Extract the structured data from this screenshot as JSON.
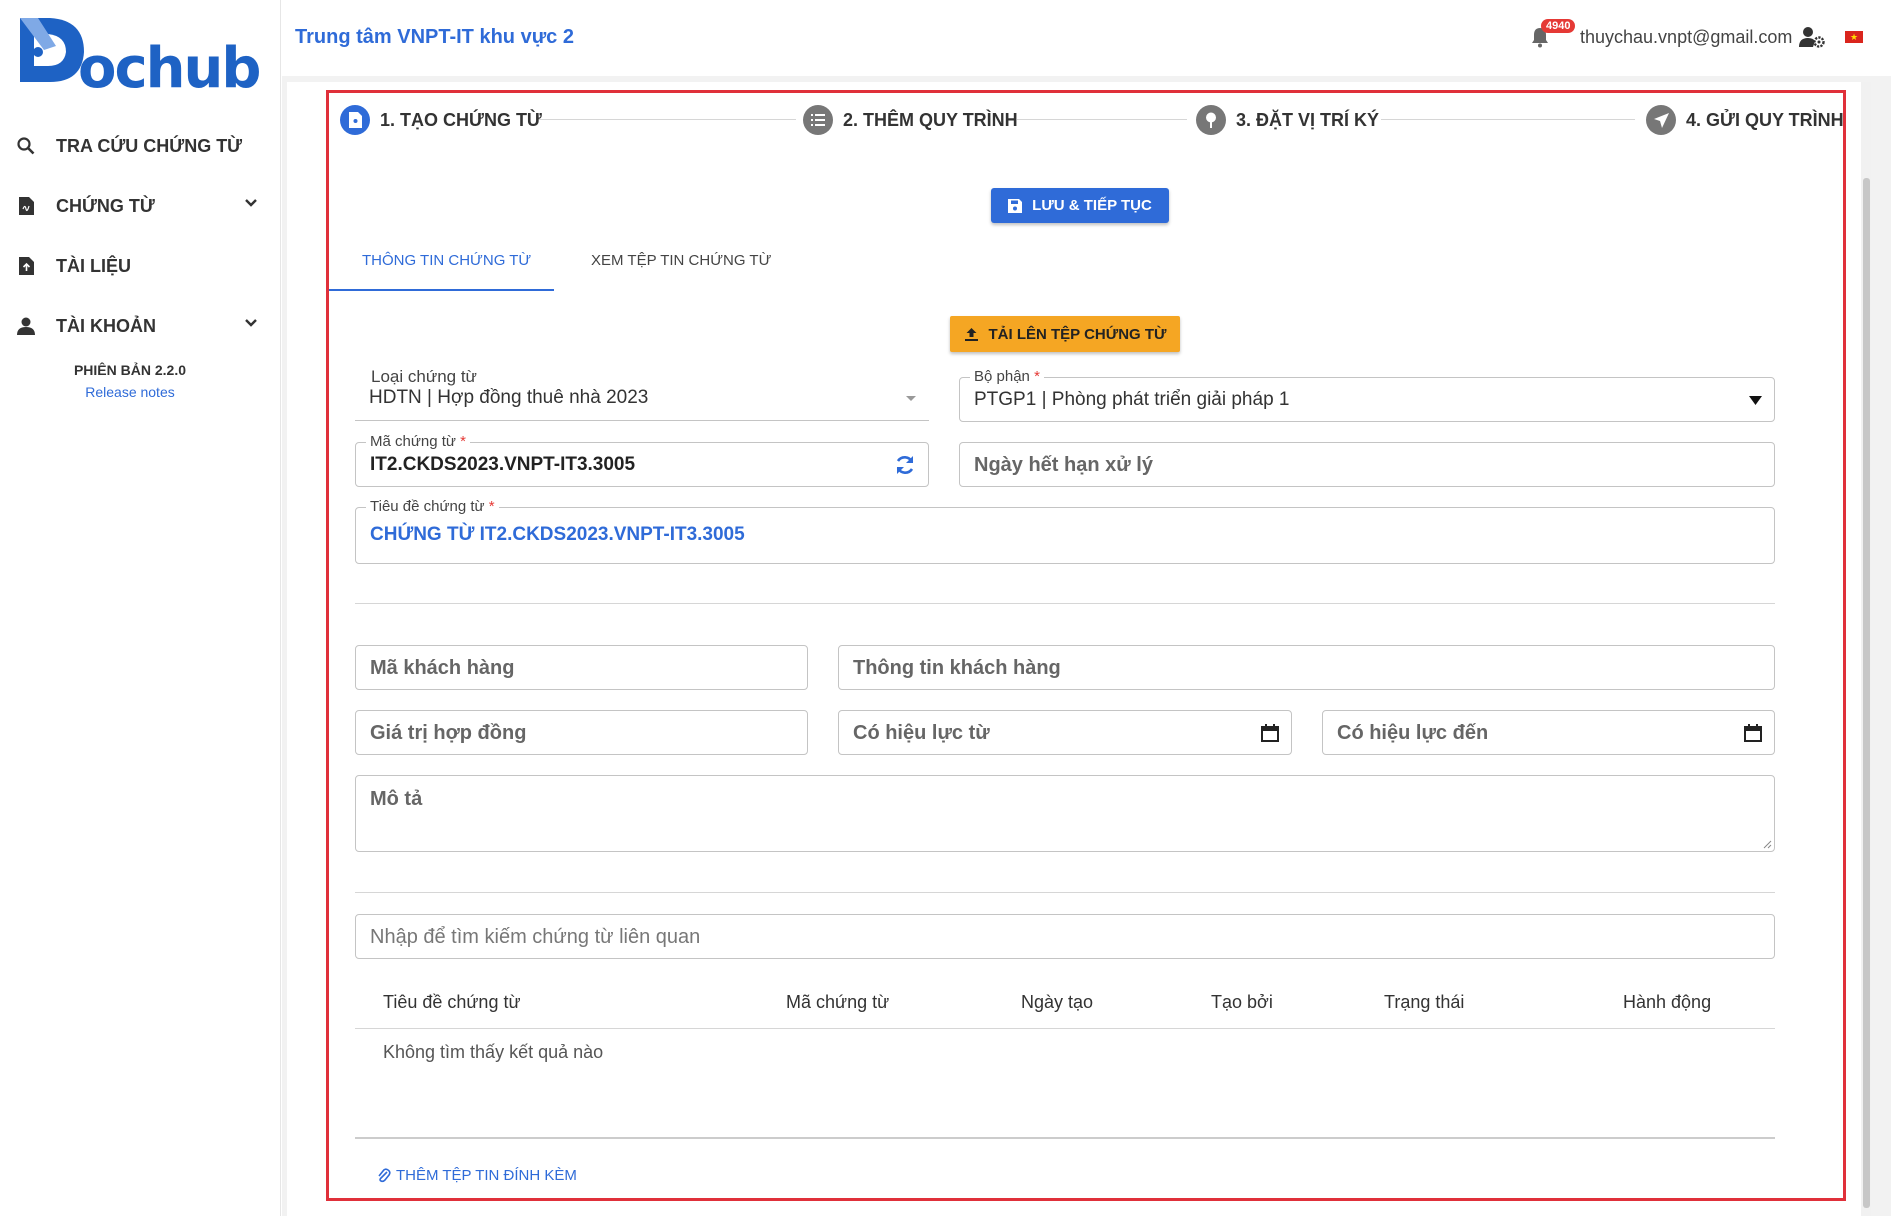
{
  "brand": {
    "logo_text": "ochub",
    "color": "#1e62c4"
  },
  "sidebar": {
    "items": [
      {
        "label": "TRA CỨU CHỨNG TỪ",
        "icon": "search-icon"
      },
      {
        "label": "CHỨNG TỪ",
        "icon": "document-icon",
        "expandable": true
      },
      {
        "label": "TÀI LIỆU",
        "icon": "file-icon"
      },
      {
        "label": "TÀI KHOẢN",
        "icon": "user-icon",
        "expandable": true
      }
    ],
    "version": "PHIÊN BẢN 2.2.0",
    "release_notes": "Release notes"
  },
  "header": {
    "org": "Trung tâm VNPT-IT khu vực 2",
    "notification_count": "4940",
    "user_email": "thuychau.vnpt@gmail.com",
    "language_flag": "vn-flag-icon"
  },
  "stepper": [
    {
      "label": "1. TẠO CHỨNG TỪ",
      "active": true
    },
    {
      "label": "2. THÊM QUY TRÌNH",
      "active": false
    },
    {
      "label": "3. ĐẶT VỊ TRÍ KÝ",
      "active": false
    },
    {
      "label": "4. GỬI QUY TRÌNH",
      "active": false
    }
  ],
  "actions": {
    "save_continue": "LƯU & TIẾP TỤC",
    "upload_document": "TẢI LÊN TỆP CHỨNG TỪ",
    "add_attachment": "THÊM TỆP TIN ĐÍNH KÈM"
  },
  "tabs": [
    {
      "label": "THÔNG TIN CHỨNG TỪ",
      "active": true
    },
    {
      "label": "XEM TỆP TIN CHỨNG TỪ",
      "active": false
    }
  ],
  "form": {
    "document_type": {
      "label": "Loại chứng từ",
      "value": "HDTN | Hợp đồng thuê nhà 2023"
    },
    "department": {
      "label": "Bộ phận",
      "required": "*",
      "value": "PTGP1 | Phòng phát triển giải pháp 1"
    },
    "document_code": {
      "label": "Mã chứng từ",
      "required": "*",
      "value": "IT2.CKDS2023.VNPT-IT3.3005"
    },
    "deadline": {
      "placeholder": "Ngày hết hạn xử lý"
    },
    "document_title": {
      "label": "Tiêu đề chứng từ",
      "required": "*",
      "value": "CHỨNG TỪ IT2.CKDS2023.VNPT-IT3.3005"
    },
    "customer_code": {
      "placeholder": "Mã khách hàng"
    },
    "customer_info": {
      "placeholder": "Thông tin khách hàng"
    },
    "contract_value": {
      "placeholder": "Giá trị hợp đồng"
    },
    "valid_from": {
      "placeholder": "Có hiệu lực từ"
    },
    "valid_to": {
      "placeholder": "Có hiệu lực đến"
    },
    "description": {
      "placeholder": "Mô tả"
    },
    "related_search": {
      "placeholder": "Nhập để tìm kiếm chứng từ liên quan"
    }
  },
  "related_table": {
    "columns": [
      "Tiêu đề chứng từ",
      "Mã chứng từ",
      "Ngày tạo",
      "Tạo bởi",
      "Trạng thái",
      "Hành động"
    ],
    "empty_text": "Không tìm thấy kết quả nào"
  },
  "colors": {
    "primary": "#2f6bd8",
    "accent": "#f5a623",
    "highlight": "#e0303a",
    "badge": "#e53935"
  }
}
